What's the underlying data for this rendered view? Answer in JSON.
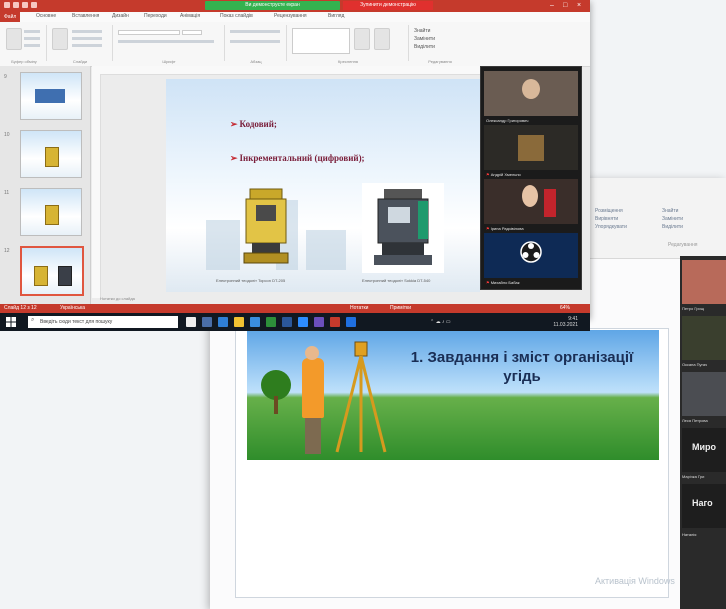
{
  "back_window": {
    "ribbon_rows": [
      "Розміщення",
      "Вирівняти",
      "Упорядкувати"
    ],
    "ribbon_right": [
      "Знайти",
      "Замінити",
      "Виділити",
      "Редагування"
    ],
    "slide_title": "1. Завдання і зміст організації угідь",
    "gallery": [
      {
        "name": "Петро Грищ",
        "big": ""
      },
      {
        "name": "Оксана Пугач",
        "big": ""
      },
      {
        "name": "Леся Петрова",
        "big": ""
      },
      {
        "name": "Марічка Гри",
        "big": "Миро"
      },
      {
        "name": "",
        "big": "Наго"
      },
      {
        "name": "Наталія",
        "big": ""
      }
    ],
    "watermark": "Активація Windows"
  },
  "front_window": {
    "title_green": "Ви демонструєте екран",
    "title_red": "Зупинити демонстрацію",
    "tabs": [
      "Файл",
      "Основне",
      "Вставлення",
      "Дизайн",
      "Переходи",
      "Анімація",
      "Показ слайдів",
      "Рецензування",
      "Вигляд"
    ],
    "ribbon_groups": [
      {
        "label": "Буфер обміну"
      },
      {
        "label": "Слайди"
      },
      {
        "label": "Шрифт"
      },
      {
        "label": "Абзац"
      },
      {
        "label": "Креслення"
      },
      {
        "label": "Редагування"
      }
    ],
    "ribbon_edit": [
      "Знайти",
      "Замінити",
      "Виділити"
    ],
    "thumbnails": [
      {
        "num": "9"
      },
      {
        "num": "10"
      },
      {
        "num": "11"
      },
      {
        "num": "12"
      }
    ],
    "slide": {
      "bullet1": "Кодовий;",
      "bullet2": "Інкрементальний (цифровий);",
      "caption1": "Електронний теодоліт Topcon DT-205",
      "caption2": "Електронний теодоліт Sokkia DT-540"
    },
    "notes_hint": "Нотатки до слайда",
    "gallery": [
      {
        "name": "Олександр Григорович"
      },
      {
        "name": "Андрій Хмельно"
      },
      {
        "name": "Ірина Радзівілова"
      },
      {
        "name": "Михайло Бабак"
      }
    ],
    "status": [
      "Слайд 12 з 12",
      "Українська",
      "Нотатки",
      "Примітки",
      "64%"
    ],
    "taskbar": {
      "search": "Введіть сюди текст для пошуку",
      "time": "9:41",
      "date": "11.03.2021"
    }
  },
  "colors": {
    "accent": "#c53a2c",
    "share_green": "#34b24f",
    "share_red": "#e0302e",
    "taskbar": "#111821"
  }
}
